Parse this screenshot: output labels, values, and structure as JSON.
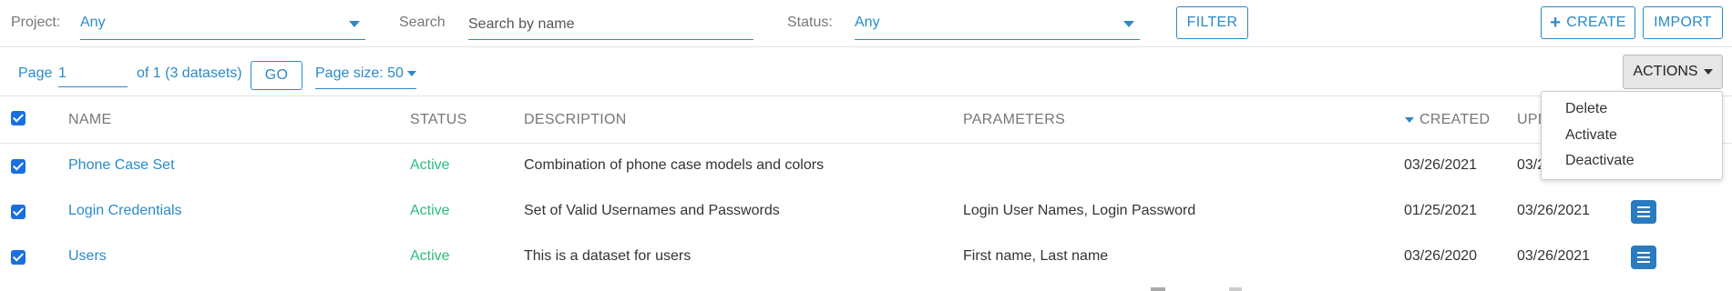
{
  "filters": {
    "project_label": "Project:",
    "project_value": "Any",
    "search_label": "Search",
    "search_placeholder": "Search by name",
    "status_label": "Status:",
    "status_value": "Any",
    "filter_button": "FILTER",
    "create_button": "CREATE",
    "import_button": "IMPORT"
  },
  "pager": {
    "page_label": "Page",
    "page_value": "1",
    "of_text": "of 1 (3 datasets)",
    "go_button": "GO",
    "page_size": "Page size: 50",
    "actions_button": "ACTIONS"
  },
  "actions_menu": [
    "Delete",
    "Activate",
    "Deactivate"
  ],
  "table": {
    "headers": {
      "name": "NAME",
      "status": "STATUS",
      "description": "DESCRIPTION",
      "parameters": "PARAMETERS",
      "created": "CREATED",
      "updated": "UPD"
    },
    "rows": [
      {
        "name": "Phone Case Set",
        "status": "Active",
        "description": "Combination of phone case models and colors",
        "parameters": "",
        "created": "03/26/2021",
        "updated": "03/2"
      },
      {
        "name": "Login Credentials",
        "status": "Active",
        "description": "Set of Valid Usernames and Passwords",
        "parameters": "Login User Names, Login Password",
        "created": "01/25/2021",
        "updated": "03/26/2021"
      },
      {
        "name": "Users",
        "status": "Active",
        "description": "This is a dataset for users",
        "parameters": "First name, Last name",
        "created": "03/26/2020",
        "updated": "03/26/2021"
      }
    ]
  },
  "colors": {
    "accent": "#2a8ac8",
    "status_active": "#2bbd7e",
    "checkbox": "#1a6fe0"
  },
  "icons": {
    "checkbox": "checkbox-checked-icon",
    "row_menu": "hamburger-menu-icon",
    "sort": "sort-desc-icon"
  }
}
